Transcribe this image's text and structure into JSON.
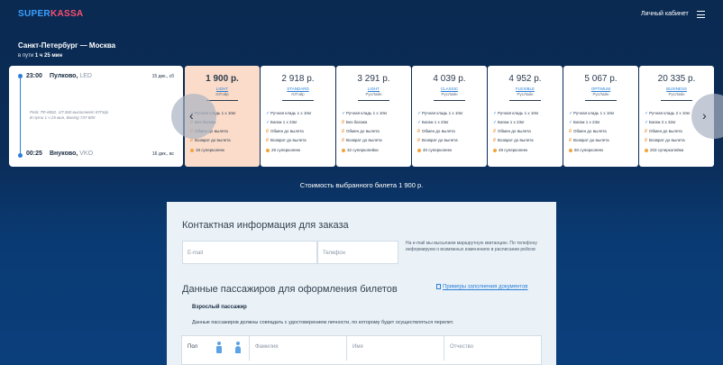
{
  "header": {
    "logo_part1": "SUPER",
    "logo_part2": "KASSA",
    "cabinet_label": "Личный кабинет",
    "menu_icon": "burger-menu-icon"
  },
  "route": {
    "title": "Санкт-Петербург — Москва",
    "duration_prefix": "в пути",
    "duration": "1 ч 25 мин"
  },
  "flight": {
    "departure_time": "23:00",
    "departure_airport": "Пулково,",
    "departure_code": "LED",
    "departure_date": "15 дек., сб",
    "info_line1": "Рейс ТФ-6062, UT-360 выполняет ЮТэйр",
    "info_line2": "В пути 1 ч 25 мин, Boeing 737-800",
    "arrival_time": "00:25",
    "arrival_airport": "Внуково,",
    "arrival_code": "VKO",
    "arrival_date": "16 дек., вс"
  },
  "fares": [
    {
      "price": "1 900 р.",
      "name": "LIGHT",
      "airline": "ЮТэйр",
      "selected": true,
      "features": [
        [
          "ok",
          "Ручная кладь 1 x 10кг"
        ],
        [
          "paid",
          "Без багажа"
        ],
        [
          "paid",
          "Обмен до вылета"
        ],
        [
          "paid",
          "Возврат до вылета"
        ],
        [
          "coin",
          "19 суперкопеек"
        ]
      ]
    },
    {
      "price": "2 918 р.",
      "name": "STANDARD",
      "airline": "ЮТэйр",
      "selected": false,
      "features": [
        [
          "ok",
          "Ручная кладь 1 x 10кг"
        ],
        [
          "ok",
          "Багаж 1 x 23кг"
        ],
        [
          "paid",
          "Обмен до вылета"
        ],
        [
          "paid",
          "Возврат до вылета"
        ],
        [
          "coin",
          "29 суперкопеек"
        ]
      ]
    },
    {
      "price": "3 291 р.",
      "name": "LIGHT",
      "airline": "РусЛайн",
      "selected": false,
      "features": [
        [
          "ok",
          "Ручная кладь 1 x 10кг"
        ],
        [
          "paid",
          "Без багажа"
        ],
        [
          "paid",
          "Обмен до вылета"
        ],
        [
          "paid",
          "Возврат до вылета"
        ],
        [
          "coin",
          "32 суперкопейки"
        ]
      ]
    },
    {
      "price": "4 039 р.",
      "name": "CLASSIC",
      "airline": "РусЛайн",
      "selected": false,
      "features": [
        [
          "ok",
          "Ручная кладь 1 x 10кг"
        ],
        [
          "ok",
          "Багаж 1 x 23кг"
        ],
        [
          "paid",
          "Обмен до вылета"
        ],
        [
          "paid",
          "Возврат до вылета"
        ],
        [
          "coin",
          "40 суперкопеек"
        ]
      ]
    },
    {
      "price": "4 952 р.",
      "name": "FLEXIBLE",
      "airline": "РусЛайн",
      "selected": false,
      "features": [
        [
          "ok",
          "Ручная кладь 1 x 10кг"
        ],
        [
          "ok",
          "Багаж 1 x 23кг"
        ],
        [
          "paid",
          "Обмен до вылета"
        ],
        [
          "paid",
          "Возврат до вылета"
        ],
        [
          "coin",
          "49 суперкопеек"
        ]
      ]
    },
    {
      "price": "5 067 р.",
      "name": "OPTIMUM",
      "airline": "РусЛайн",
      "selected": false,
      "features": [
        [
          "ok",
          "Ручная кладь 1 x 10кг"
        ],
        [
          "ok",
          "Багаж 1 x 23кг"
        ],
        [
          "paid",
          "Обмен до вылета"
        ],
        [
          "paid",
          "Возврат до вылета"
        ],
        [
          "coin",
          "50 суперкопеек"
        ]
      ]
    },
    {
      "price": "20 335 р.",
      "name": "BUSINESS",
      "airline": "РусЛайн",
      "selected": false,
      "features": [
        [
          "ok",
          "Ручная кладь 2 x 10кг"
        ],
        [
          "ok",
          "Багаж 2 x 32кг"
        ],
        [
          "paid",
          "Обмен до вылета"
        ],
        [
          "paid",
          "Возврат до вылета"
        ],
        [
          "coin",
          "203 суперкопейки"
        ]
      ]
    }
  ],
  "nav": {
    "prev": "‹",
    "next": "›"
  },
  "cost_text": "Стоимость выбранного билета 1 900 р.",
  "contact": {
    "title": "Контактная информация для заказа",
    "email_placeholder": "E-mail",
    "phone_placeholder": "Телефон",
    "note": "На e-mail мы высылаем маршрутную квитанцию. По телефону информируем о возможных изменениях в расписании рейсов"
  },
  "passengers": {
    "title": "Данные пассажиров для оформления билетов",
    "examples_link": "Примеры заполнения документов",
    "adult_title": "Взрослый пассажир",
    "hint": "Данные пассажиров должны совпадать с удостоверением личности, по которому будет осуществляться перелет.",
    "gender_label": "Пол",
    "surname": "Фамилия",
    "name": "Имя",
    "patronymic": "Отчество"
  }
}
